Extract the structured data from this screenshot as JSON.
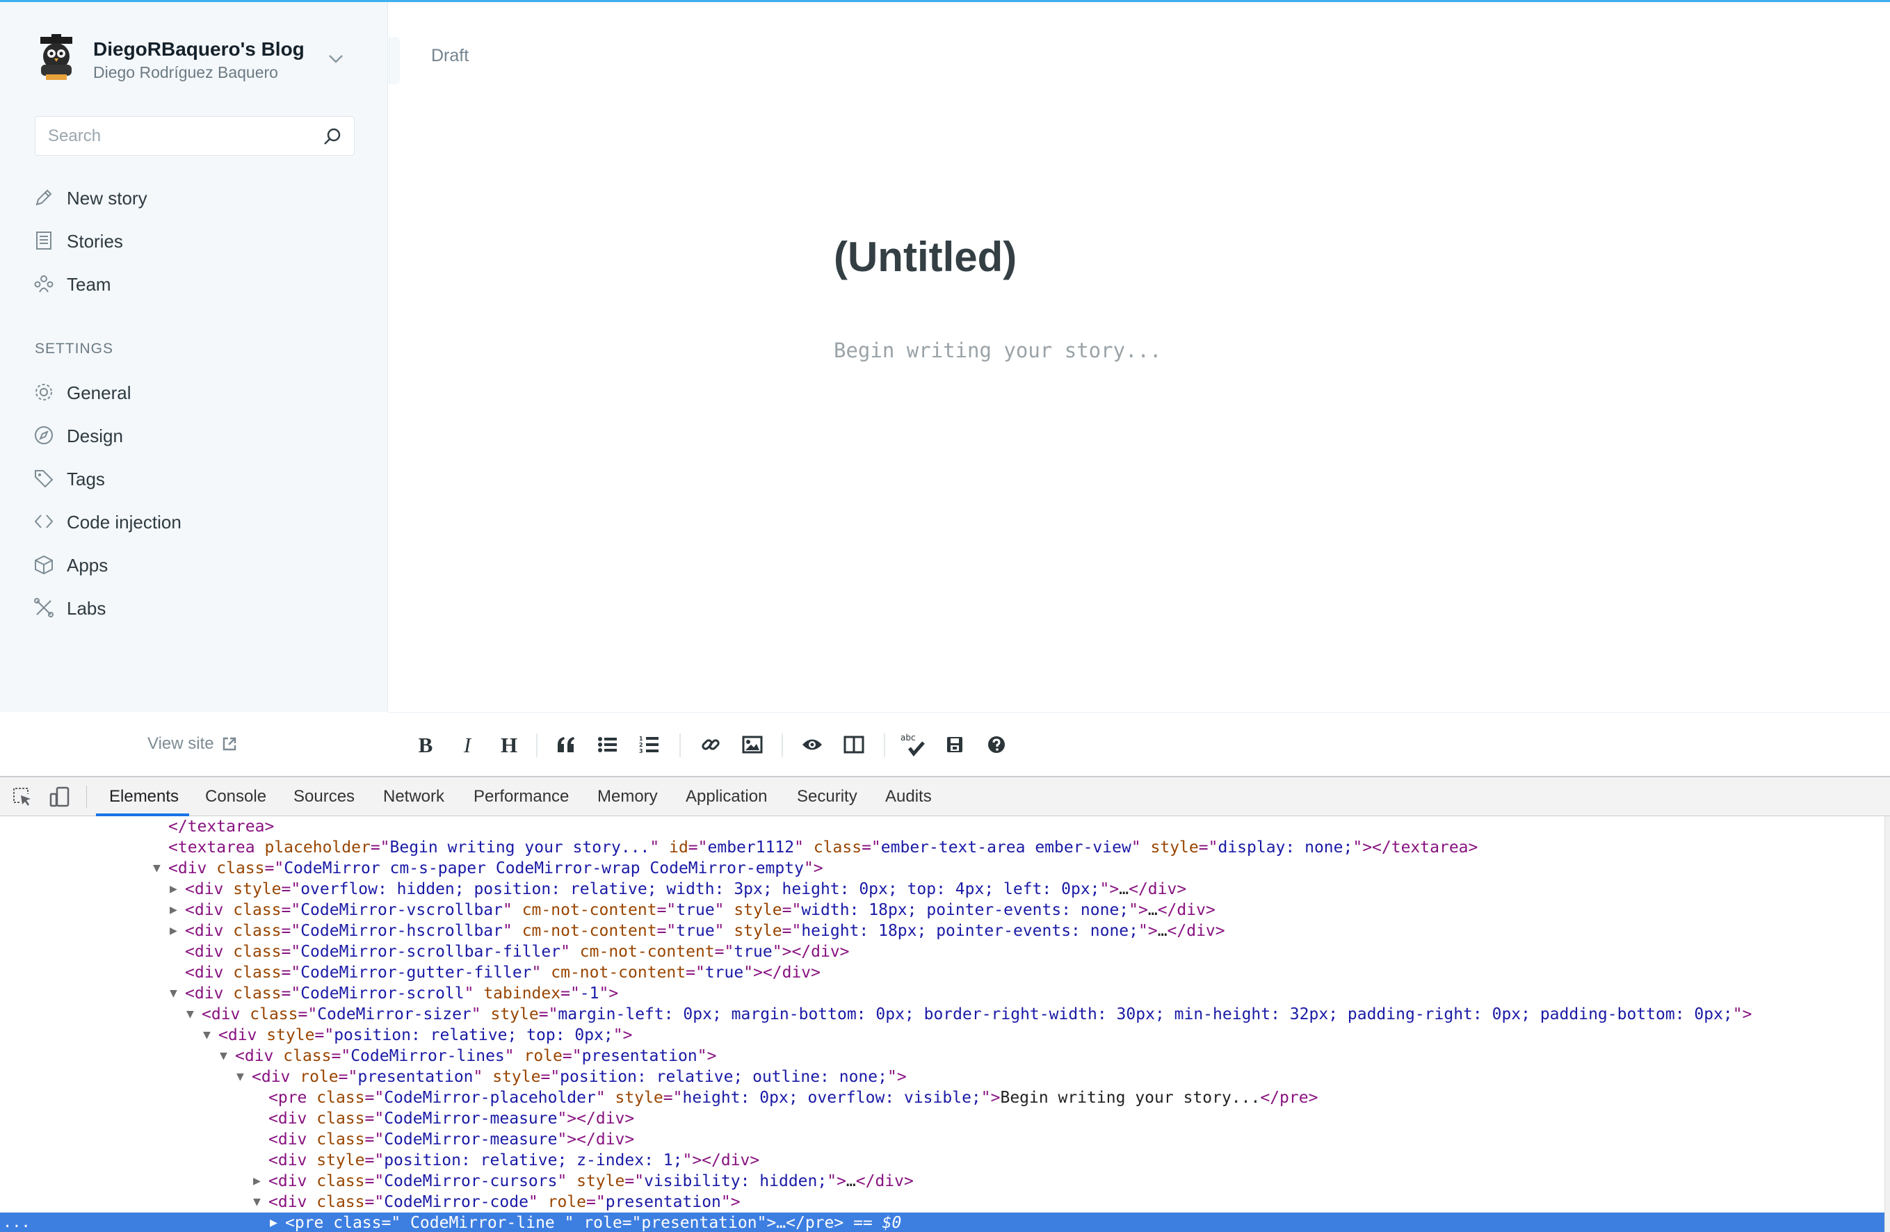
{
  "sidebar": {
    "blog_title": "DiegoRBaquero's Blog",
    "user_name": "Diego Rodríguez Baquero",
    "search_placeholder": "Search",
    "nav": [
      {
        "label": "New story",
        "icon": "pencil-icon"
      },
      {
        "label": "Stories",
        "icon": "list-icon"
      },
      {
        "label": "Team",
        "icon": "team-icon"
      }
    ],
    "settings_header": "SETTINGS",
    "settings": [
      {
        "label": "General",
        "icon": "gear-icon"
      },
      {
        "label": "Design",
        "icon": "compass-icon"
      },
      {
        "label": "Tags",
        "icon": "tag-icon"
      },
      {
        "label": "Code injection",
        "icon": "code-icon"
      },
      {
        "label": "Apps",
        "icon": "box-icon"
      },
      {
        "label": "Labs",
        "icon": "tools-icon"
      }
    ],
    "view_site": "View site"
  },
  "editor": {
    "status": "Draft",
    "title": "(Untitled)",
    "body_placeholder": "Begin writing your story..."
  },
  "toolbar": {
    "bold": "B",
    "italic": "I",
    "heading": "H",
    "spellcheck_label": "abc"
  },
  "devtools": {
    "tabs": [
      "Elements",
      "Console",
      "Sources",
      "Network",
      "Performance",
      "Memory",
      "Application",
      "Security",
      "Audits"
    ],
    "active_tab": "Elements",
    "lines": [
      {
        "indent": 10,
        "arrow": "",
        "parts": [
          [
            "tag",
            "</textarea>"
          ]
        ]
      },
      {
        "indent": 10,
        "arrow": "",
        "parts": [
          [
            "tag",
            "<textarea "
          ],
          [
            "an",
            "placeholder"
          ],
          [
            "tag",
            "=\""
          ],
          [
            "av",
            "Begin writing your story..."
          ],
          [
            "tag",
            "\" "
          ],
          [
            "an",
            "id"
          ],
          [
            "tag",
            "=\""
          ],
          [
            "av",
            "ember1112"
          ],
          [
            "tag",
            "\" "
          ],
          [
            "an",
            "class"
          ],
          [
            "tag",
            "=\""
          ],
          [
            "av",
            "ember-text-area ember-view"
          ],
          [
            "tag",
            "\" "
          ],
          [
            "an",
            "style"
          ],
          [
            "tag",
            "=\""
          ],
          [
            "av",
            "display: none;"
          ],
          [
            "tag",
            "\"></textarea>"
          ]
        ]
      },
      {
        "indent": 10,
        "arrow": "▼",
        "parts": [
          [
            "tag",
            "<div "
          ],
          [
            "an",
            "class"
          ],
          [
            "tag",
            "=\""
          ],
          [
            "av",
            "CodeMirror cm-s-paper CodeMirror-wrap CodeMirror-empty"
          ],
          [
            "tag",
            "\">"
          ]
        ]
      },
      {
        "indent": 11,
        "arrow": "▶",
        "parts": [
          [
            "tag",
            "<div "
          ],
          [
            "an",
            "style"
          ],
          [
            "tag",
            "=\""
          ],
          [
            "av",
            "overflow: hidden; position: relative; width: 3px; height: 0px; top: 4px; left: 0px;"
          ],
          [
            "tag",
            "\">"
          ],
          [
            "tx",
            "…"
          ],
          [
            "tag",
            "</div>"
          ]
        ]
      },
      {
        "indent": 11,
        "arrow": "▶",
        "parts": [
          [
            "tag",
            "<div "
          ],
          [
            "an",
            "class"
          ],
          [
            "tag",
            "=\""
          ],
          [
            "av",
            "CodeMirror-vscrollbar"
          ],
          [
            "tag",
            "\" "
          ],
          [
            "an",
            "cm-not-content"
          ],
          [
            "tag",
            "=\""
          ],
          [
            "av",
            "true"
          ],
          [
            "tag",
            "\" "
          ],
          [
            "an",
            "style"
          ],
          [
            "tag",
            "=\""
          ],
          [
            "av",
            "width: 18px; pointer-events: none;"
          ],
          [
            "tag",
            "\">"
          ],
          [
            "tx",
            "…"
          ],
          [
            "tag",
            "</div>"
          ]
        ]
      },
      {
        "indent": 11,
        "arrow": "▶",
        "parts": [
          [
            "tag",
            "<div "
          ],
          [
            "an",
            "class"
          ],
          [
            "tag",
            "=\""
          ],
          [
            "av",
            "CodeMirror-hscrollbar"
          ],
          [
            "tag",
            "\" "
          ],
          [
            "an",
            "cm-not-content"
          ],
          [
            "tag",
            "=\""
          ],
          [
            "av",
            "true"
          ],
          [
            "tag",
            "\" "
          ],
          [
            "an",
            "style"
          ],
          [
            "tag",
            "=\""
          ],
          [
            "av",
            "height: 18px; pointer-events: none;"
          ],
          [
            "tag",
            "\">"
          ],
          [
            "tx",
            "…"
          ],
          [
            "tag",
            "</div>"
          ]
        ]
      },
      {
        "indent": 11,
        "arrow": "",
        "parts": [
          [
            "tag",
            "<div "
          ],
          [
            "an",
            "class"
          ],
          [
            "tag",
            "=\""
          ],
          [
            "av",
            "CodeMirror-scrollbar-filler"
          ],
          [
            "tag",
            "\" "
          ],
          [
            "an",
            "cm-not-content"
          ],
          [
            "tag",
            "=\""
          ],
          [
            "av",
            "true"
          ],
          [
            "tag",
            "\"></div>"
          ]
        ]
      },
      {
        "indent": 11,
        "arrow": "",
        "parts": [
          [
            "tag",
            "<div "
          ],
          [
            "an",
            "class"
          ],
          [
            "tag",
            "=\""
          ],
          [
            "av",
            "CodeMirror-gutter-filler"
          ],
          [
            "tag",
            "\" "
          ],
          [
            "an",
            "cm-not-content"
          ],
          [
            "tag",
            "=\""
          ],
          [
            "av",
            "true"
          ],
          [
            "tag",
            "\"></div>"
          ]
        ]
      },
      {
        "indent": 11,
        "arrow": "▼",
        "parts": [
          [
            "tag",
            "<div "
          ],
          [
            "an",
            "class"
          ],
          [
            "tag",
            "=\""
          ],
          [
            "av",
            "CodeMirror-scroll"
          ],
          [
            "tag",
            "\" "
          ],
          [
            "an",
            "tabindex"
          ],
          [
            "tag",
            "=\""
          ],
          [
            "av",
            "-1"
          ],
          [
            "tag",
            "\">"
          ]
        ]
      },
      {
        "indent": 12,
        "arrow": "▼",
        "parts": [
          [
            "tag",
            "<div "
          ],
          [
            "an",
            "class"
          ],
          [
            "tag",
            "=\""
          ],
          [
            "av",
            "CodeMirror-sizer"
          ],
          [
            "tag",
            "\" "
          ],
          [
            "an",
            "style"
          ],
          [
            "tag",
            "=\""
          ],
          [
            "av",
            "margin-left: 0px; margin-bottom: 0px; border-right-width: 30px; min-height: 32px; padding-right: 0px; padding-bottom: 0px;"
          ],
          [
            "tag",
            "\">"
          ]
        ]
      },
      {
        "indent": 13,
        "arrow": "▼",
        "parts": [
          [
            "tag",
            "<div "
          ],
          [
            "an",
            "style"
          ],
          [
            "tag",
            "=\""
          ],
          [
            "av",
            "position: relative; top: 0px;"
          ],
          [
            "tag",
            "\">"
          ]
        ]
      },
      {
        "indent": 14,
        "arrow": "▼",
        "parts": [
          [
            "tag",
            "<div "
          ],
          [
            "an",
            "class"
          ],
          [
            "tag",
            "=\""
          ],
          [
            "av",
            "CodeMirror-lines"
          ],
          [
            "tag",
            "\" "
          ],
          [
            "an",
            "role"
          ],
          [
            "tag",
            "=\""
          ],
          [
            "av",
            "presentation"
          ],
          [
            "tag",
            "\">"
          ]
        ]
      },
      {
        "indent": 15,
        "arrow": "▼",
        "parts": [
          [
            "tag",
            "<div "
          ],
          [
            "an",
            "role"
          ],
          [
            "tag",
            "=\""
          ],
          [
            "av",
            "presentation"
          ],
          [
            "tag",
            "\" "
          ],
          [
            "an",
            "style"
          ],
          [
            "tag",
            "=\""
          ],
          [
            "av",
            "position: relative; outline: none;"
          ],
          [
            "tag",
            "\">"
          ]
        ]
      },
      {
        "indent": 16,
        "arrow": "",
        "parts": [
          [
            "tag",
            "<pre "
          ],
          [
            "an",
            "class"
          ],
          [
            "tag",
            "=\""
          ],
          [
            "av",
            "CodeMirror-placeholder"
          ],
          [
            "tag",
            "\" "
          ],
          [
            "an",
            "style"
          ],
          [
            "tag",
            "=\""
          ],
          [
            "av",
            "height: 0px; overflow: visible;"
          ],
          [
            "tag",
            "\">"
          ],
          [
            "tx",
            "Begin writing your story..."
          ],
          [
            "tag",
            "</pre>"
          ]
        ]
      },
      {
        "indent": 16,
        "arrow": "",
        "parts": [
          [
            "tag",
            "<div "
          ],
          [
            "an",
            "class"
          ],
          [
            "tag",
            "=\""
          ],
          [
            "av",
            "CodeMirror-measure"
          ],
          [
            "tag",
            "\"></div>"
          ]
        ]
      },
      {
        "indent": 16,
        "arrow": "",
        "parts": [
          [
            "tag",
            "<div "
          ],
          [
            "an",
            "class"
          ],
          [
            "tag",
            "=\""
          ],
          [
            "av",
            "CodeMirror-measure"
          ],
          [
            "tag",
            "\"></div>"
          ]
        ]
      },
      {
        "indent": 16,
        "arrow": "",
        "parts": [
          [
            "tag",
            "<div "
          ],
          [
            "an",
            "style"
          ],
          [
            "tag",
            "=\""
          ],
          [
            "av",
            "position: relative; z-index: 1;"
          ],
          [
            "tag",
            "\"></div>"
          ]
        ]
      },
      {
        "indent": 16,
        "arrow": "▶",
        "parts": [
          [
            "tag",
            "<div "
          ],
          [
            "an",
            "class"
          ],
          [
            "tag",
            "=\""
          ],
          [
            "av",
            "CodeMirror-cursors"
          ],
          [
            "tag",
            "\" "
          ],
          [
            "an",
            "style"
          ],
          [
            "tag",
            "=\""
          ],
          [
            "av",
            "visibility: hidden;"
          ],
          [
            "tag",
            "\">"
          ],
          [
            "tx",
            "…"
          ],
          [
            "tag",
            "</div>"
          ]
        ]
      },
      {
        "indent": 16,
        "arrow": "▼",
        "parts": [
          [
            "tag",
            "<div "
          ],
          [
            "an",
            "class"
          ],
          [
            "tag",
            "=\""
          ],
          [
            "av",
            "CodeMirror-code"
          ],
          [
            "tag",
            "\" "
          ],
          [
            "an",
            "role"
          ],
          [
            "tag",
            "=\""
          ],
          [
            "av",
            "presentation"
          ],
          [
            "tag",
            "\">"
          ]
        ]
      },
      {
        "indent": 17,
        "arrow": "▶",
        "selected": true,
        "parts": [
          [
            "tag",
            "<pre "
          ],
          [
            "an",
            "class"
          ],
          [
            "tag",
            "=\""
          ],
          [
            "av",
            " CodeMirror-line "
          ],
          [
            "tag",
            "\" "
          ],
          [
            "an",
            "role"
          ],
          [
            "tag",
            "=\""
          ],
          [
            "av",
            "presentation"
          ],
          [
            "tag",
            "\">"
          ],
          [
            "tx",
            "…"
          ],
          [
            "tag",
            "</pre>"
          ],
          [
            "dl",
            " == $0"
          ]
        ]
      }
    ],
    "selected_prefix": "..."
  }
}
